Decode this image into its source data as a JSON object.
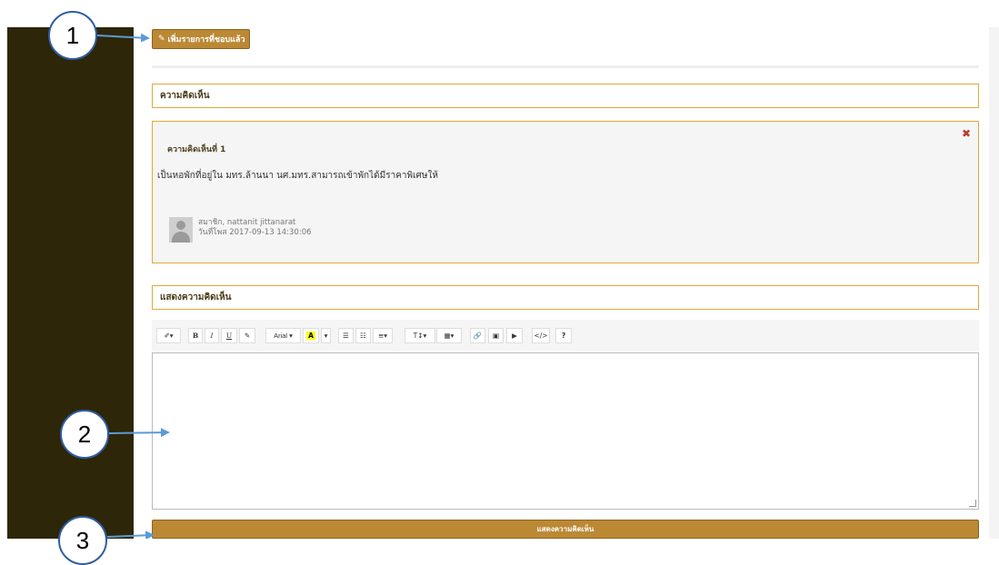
{
  "add_button": {
    "label": "เพิ่มรายการที่ชอบแล้ว",
    "icon": "pencil-icon"
  },
  "comments_section": {
    "title": "ความคิดเห็น"
  },
  "comment": {
    "title": "ความคิดเห็นที่ 1",
    "body": "เป็นหอพักที่อยู่ใน มทร.ล้านนา นศ.มทร.สามารถเข้าพักได้มีราคาพิเศษให้",
    "author": "สมาชิก, nattanit jittanarat",
    "date": "วันที่โพส 2017-09-13 14:30:06",
    "close_symbol": "✖"
  },
  "post_section": {
    "title": "แสดงความคิดเห็น"
  },
  "toolbar": {
    "style": "✐▾",
    "bold": "B",
    "italic": "I",
    "underline": "U",
    "eraser": "✎",
    "font": "Arial ▾",
    "color": "A",
    "color_caret": "▾",
    "ul": "☰",
    "ol": "☷",
    "align": "≡▾",
    "height": "T↕▾",
    "table": "▦▾",
    "link": "🔗",
    "picture": "▣",
    "video": "▶",
    "code": "</>",
    "help": "?"
  },
  "editor": {
    "value": ""
  },
  "submit_button": {
    "label": "แสดงความคิดเห็น"
  },
  "callouts": [
    "1",
    "2",
    "3"
  ],
  "colors": {
    "accent": "#bb8834",
    "border": "#dfa93a",
    "sidebar": "#2e2608",
    "callout": "#2e5da3",
    "arrow": "#5b9bd5"
  }
}
